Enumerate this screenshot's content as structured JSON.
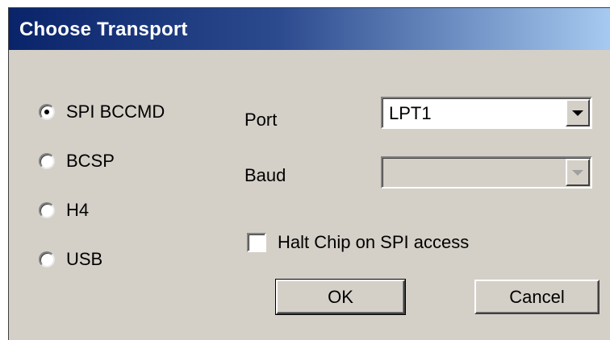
{
  "window": {
    "title": "Choose Transport"
  },
  "transport": {
    "selected": "SPI BCCMD",
    "options": [
      {
        "label": "SPI BCCMD",
        "checked": true
      },
      {
        "label": "BCSP",
        "checked": false
      },
      {
        "label": "H4",
        "checked": false
      },
      {
        "label": "USB",
        "checked": false
      }
    ]
  },
  "port": {
    "label": "Port",
    "value": "LPT1",
    "icon": "chevron-down-icon"
  },
  "baud": {
    "label": "Baud",
    "value": "",
    "disabled": true,
    "icon": "chevron-down-icon"
  },
  "halt": {
    "label": "Halt Chip on SPI access",
    "checked": false
  },
  "buttons": {
    "ok_label": "OK",
    "cancel_label": "Cancel"
  },
  "colors": {
    "dialog_face": "#d4d0c8",
    "titlebar_start": "#0a246a",
    "titlebar_end": "#a6caf0",
    "title_text": "#ffffff"
  }
}
